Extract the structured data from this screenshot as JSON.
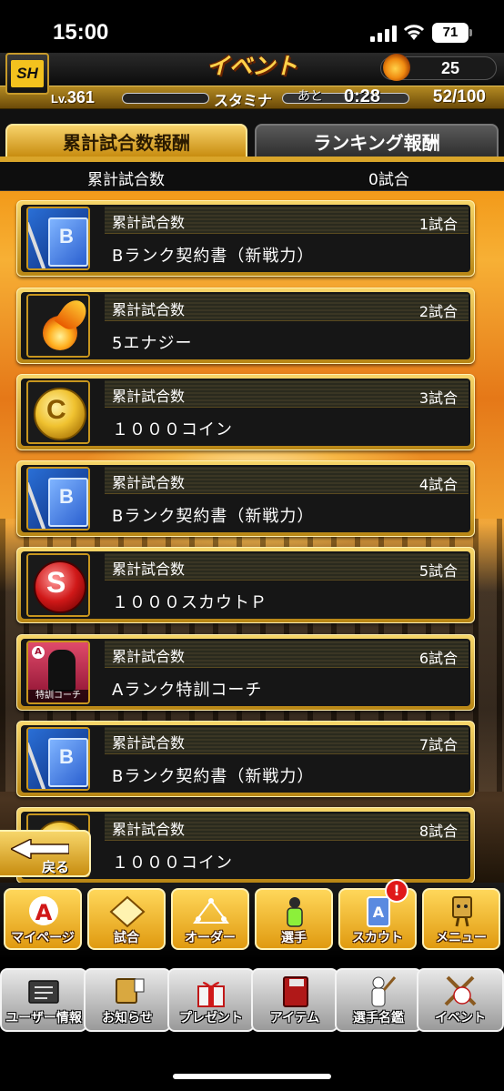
{
  "status_bar": {
    "time": "15:00",
    "battery": "71"
  },
  "header": {
    "title": "イベント",
    "energy": "25"
  },
  "level_bar": {
    "lv_prefix": "Lv.",
    "lv": "361",
    "stamina_label": "スタミナ",
    "ato": "あと",
    "timer": "0:28",
    "stamina": "52/100"
  },
  "tabs": [
    {
      "label": "累計試合数報酬",
      "active": true
    },
    {
      "label": "ランキング報酬",
      "active": false
    }
  ],
  "count_bar": {
    "label": "累計試合数",
    "value": "0試合"
  },
  "rewards": [
    {
      "header": "累計試合数",
      "count": "1試合",
      "name": "Bランク契約書（新戦力）",
      "icon": "contract-book-icon"
    },
    {
      "header": "累計試合数",
      "count": "2試合",
      "name": "5エナジー",
      "icon": "energy-fire-icon"
    },
    {
      "header": "累計試合数",
      "count": "3試合",
      "name": "１０００コイン",
      "icon": "coin-icon"
    },
    {
      "header": "累計試合数",
      "count": "4試合",
      "name": "Bランク契約書（新戦力）",
      "icon": "contract-book-icon"
    },
    {
      "header": "累計試合数",
      "count": "5試合",
      "name": "１０００スカウトＰ",
      "icon": "scout-point-icon"
    },
    {
      "header": "累計試合数",
      "count": "6試合",
      "name": "Aランク特訓コーチ",
      "icon": "coach-card-icon",
      "icon_label": "特訓コーチ"
    },
    {
      "header": "累計試合数",
      "count": "7試合",
      "name": "Bランク契約書（新戦力）",
      "icon": "contract-book-icon"
    },
    {
      "header": "累計試合数",
      "count": "8試合",
      "name": "１０００コイン",
      "icon": "coin-icon"
    }
  ],
  "back_button": {
    "label": "戻る"
  },
  "nav_primary": [
    {
      "label": "マイページ"
    },
    {
      "label": "試合"
    },
    {
      "label": "オーダー"
    },
    {
      "label": "選手"
    },
    {
      "label": "スカウト",
      "badge": "!"
    },
    {
      "label": "メニュー"
    }
  ],
  "nav_secondary": [
    {
      "label": "ユーザー情報"
    },
    {
      "label": "お知らせ"
    },
    {
      "label": "プレゼント"
    },
    {
      "label": "アイテム"
    },
    {
      "label": "選手名鑑"
    },
    {
      "label": "イベント"
    }
  ],
  "colors": {
    "gold": "#d9a52a",
    "orange_bg": "#f0a230",
    "badge_red": "#e01818"
  }
}
